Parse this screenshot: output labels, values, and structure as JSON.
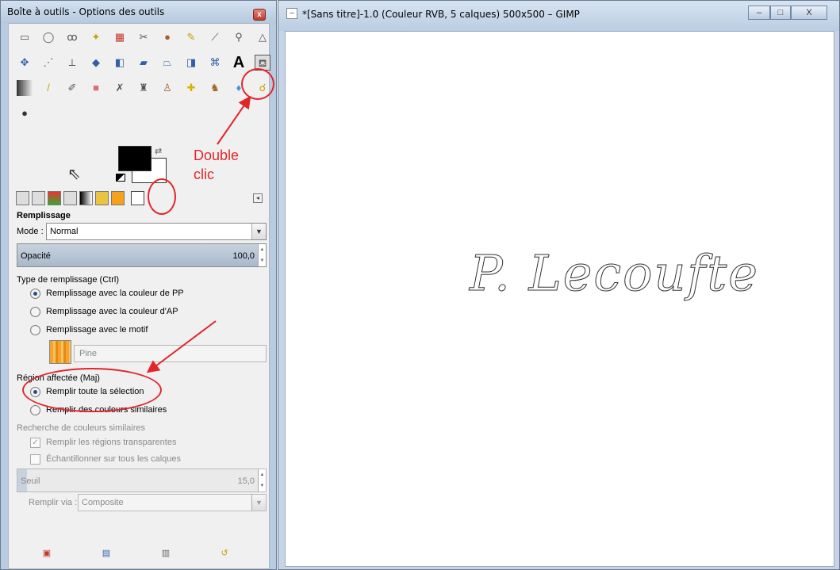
{
  "toolbox": {
    "title": "Boîte à outils - Options des outils",
    "close_label": "x",
    "tools": {
      "row1": [
        "rect-select",
        "ellipse-select",
        "free-select",
        "fuzzy-select",
        "select-by-color",
        "scissors",
        "foreground-select",
        "paths",
        "color-picker",
        "zoom",
        "measure"
      ],
      "row2": [
        "move",
        "align",
        "crop",
        "rotate",
        "scale",
        "shear",
        "perspective",
        "flip",
        "cage",
        "text",
        "bucket-fill"
      ],
      "row3": [
        "blend",
        "pencil",
        "paintbrush",
        "eraser",
        "airbrush",
        "ink",
        "clone",
        "heal",
        "perspective-clone",
        "blur",
        "smudge"
      ],
      "row4": [
        "dodge-burn"
      ]
    },
    "options": {
      "section_title": "Remplissage",
      "mode_label": "Mode :",
      "mode_value": "Normal",
      "opacity_label": "Opacité",
      "opacity_value": "100,0",
      "fill_type_label": "Type de remplissage (Ctrl)",
      "fill_fg": "Remplissage avec la couleur de PP",
      "fill_bg": "Remplissage avec la couleur d'AP",
      "fill_pattern": "Remplissage avec le motif",
      "pattern_name": "Pine",
      "region_label": "Région affectée (Maj)",
      "region_all": "Remplir toute la sélection",
      "region_similar": "Remplir des couleurs similaires",
      "similar_label": "Recherche de couleurs similaires",
      "fill_transparent": "Remplir les régions transparentes",
      "sample_merged": "Échantillonner sur tous les calques",
      "threshold_label": "Seuil",
      "threshold_value": "15,0",
      "fill_by_label": "Remplir via :",
      "fill_by_value": "Composite"
    }
  },
  "annotation": {
    "line1": "Double",
    "line2": "clic"
  },
  "image_window": {
    "title": "*[Sans titre]-1.0 (Couleur RVB, 5 calques) 500x500 – GIMP",
    "minimize": "–",
    "maximize": "□",
    "close": "X",
    "canvas_text": "P. Lecoufte"
  }
}
